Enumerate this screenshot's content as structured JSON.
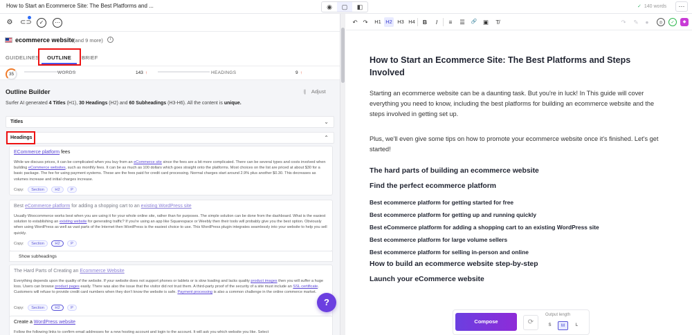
{
  "topbar": {
    "doc_title": "How to Start an Ecommerce Site: The Best Platforms and ...",
    "word_count": "140 words",
    "more": "⋯"
  },
  "keyword": {
    "main": "ecommerce website",
    "more": "(and 9 more)"
  },
  "tabs": [
    {
      "label": "GUIDELINES"
    },
    {
      "label": "OUTLINE"
    },
    {
      "label": "BRIEF"
    }
  ],
  "stats": {
    "score": "35",
    "words_label": "WORDS",
    "words_value": "143",
    "headings_label": "HEADINGS",
    "headings_value": "9",
    "up_arrow": "↑"
  },
  "outline": {
    "title": "Outline Builder",
    "adjust": "Adjust",
    "desc_pre": "Surfer AI generated ",
    "titles_count": "4 Titles",
    "desc_h1": " (H1), ",
    "headings_count": "30 Headings",
    "desc_h2": " (H2) and ",
    "subheadings_count": "60 Subheadings",
    "desc_h3": " (H3-H6). All the content is ",
    "unique": "unique.",
    "sections": {
      "titles": "Titles",
      "headings": "Headings"
    },
    "copy_label": "Copy:",
    "pill_section": "Section",
    "pill_h2": "H2",
    "pill_p": "P",
    "show_sub": "Show subheadings",
    "cards": [
      {
        "title_link": "ECommerce platform",
        "title_rest": " fees",
        "p_1": "While we discuss prices, it can be complicated when you buy from an ",
        "p_link_1": "eCommerce site",
        "p_2": " since the fees are a bit more complicated. There can be several types and costs involved when building ",
        "p_link_2": "eCommerce websites",
        "p_3": ", such as monthly fees. It can be as much as 100 dollars which goes straight onto the platforms. Most choices on the list are priced at about $30 for a basic package. The fee for using payment systems. These are the fees paid for credit card processing. Normal charges start around 2.9% plus another $0.30. This decreases as volumes increase and initial charges increase."
      },
      {
        "title_pre": "Best ",
        "title_link_1": "eCommerce platform",
        "title_mid": " for adding a shopping cart to an ",
        "title_link_2": "existing WordPress site",
        "p_1": "Usually Woocommerce works best when you are using it for your whole online site, rather than for purposes. The simple solution can be done from the dashboard. What is the easiest solution to establishing an ",
        "p_link_1": "existing website",
        "p_2": " for generating traffic? If you're using an app like Squarespace or Weebly then their tools will probably give you the best option. Obviously when using WordPress as well as vast parts of the Internet then WordPress is the easiest choice to use. This WordPress plugin integrates seamlessly into your website to help you sell quickly."
      },
      {
        "title_pre": "The Hard Parts of Creating an ",
        "title_link": "Ecommerce Website",
        "p_1": "Everything depends upon the quality of the website. If your website does not support phones or tablets or is slow loading and lacks quality ",
        "p_link_1": "product images",
        "p_2": " then you will suffer a huge loss. Users can browse ",
        "p_link_2": "product pages",
        "p_3": " easily. There was also the issue that the visitor did not trust them. A third-party proof of the security of a site must include an ",
        "p_link_3": "SSL certificate",
        "p_4": ". Customers will refuse to provide credit card numbers when they don't know the website is safe. ",
        "p_link_4": "Payment processing",
        "p_5": " is also a common challenge in the online commerce market."
      },
      {
        "title_pre": "Create a ",
        "title_link": "WordPress website",
        "p_1": "Follow the following links to confirm email addresses for a new hosting account and login to the account. It will ask you which website you like. Select"
      }
    ]
  },
  "help_fab": "?",
  "editor": {
    "h1": "How to Start an Ecommerce Site: The Best Platforms and Steps Involved",
    "p1": "Starting an ecommerce website can be a daunting task. But you're in luck! In This guide will cover everything you need to know, including the best platforms for building an ecommerce website and the steps involved in getting set up.",
    "p2": "Plus, we'll even give some tips on how to promote your ecommerce website once it's finished. Let's get started!",
    "h2_1": "The hard parts of building an ecommerce website",
    "h2_2": "Find the perfect ecommerce platform",
    "h3_list": [
      "Best ecommerce platform for getting started for free",
      "Best ecommerce platform for getting up and running quickly",
      "Best eCommerce platform for adding a shopping cart to an existing WordPress site",
      "Best ecommerce platform for large volume sellers",
      "Best ecommerce platform for selling in-person and online"
    ],
    "h2_3": "How to build an ecommerce website step-by-step",
    "h2_4": "Launch your eCommerce website"
  },
  "toolbar": {
    "undo": "↶",
    "redo": "↷",
    "h1": "H1",
    "h2": "H2",
    "h3": "H3",
    "h4": "H4",
    "bold": "B",
    "italic": "I",
    "ol": "≡",
    "ul": "☰",
    "link": "🔗",
    "image": "▣",
    "clear": "T̸"
  },
  "compose": {
    "button": "Compose",
    "output_length": "Output length",
    "sizes": [
      "S",
      "M",
      "L"
    ]
  },
  "colors": {
    "accent": "#6b3fe0",
    "highlight_box": "#e11111",
    "link": "#5a45d6"
  }
}
